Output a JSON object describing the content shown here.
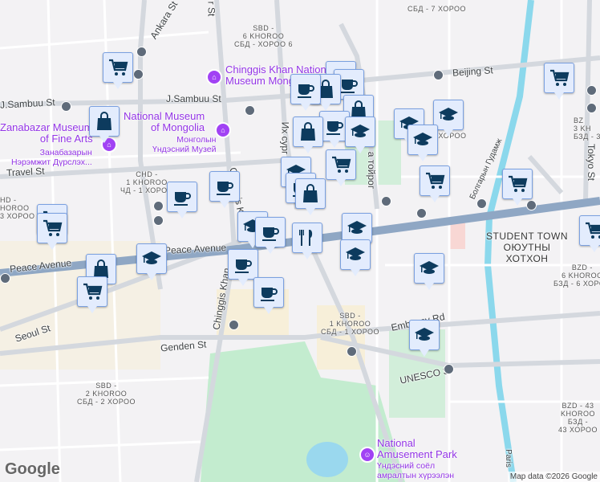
{
  "streets": {
    "ankara": "Ankara St",
    "jsambuu_w": "J.Sambuu St",
    "jsambuu_e": "J.Sambuu St",
    "travel": "Travel St",
    "peace_w": "Peace Avenue",
    "peace_e": "Peace Avenue",
    "seoul": "Seoul St",
    "genden": "Genden St",
    "chinggis_n": "Chinggis Khan",
    "chinggis_s": "Chinggis Khan",
    "ih_surguuli": "Их сург",
    "beijing": "Beijing St",
    "embassy": "Embassy Rd",
    "unesco": "UNESCO St",
    "tokyo": "Tokyo St",
    "bolgar": "Болгарын Гудамж",
    "toirog": "а тойрог",
    "paris": "Paris",
    "chr_st": "r St"
  },
  "districts": {
    "sbd6": "SBD -\n6 KHOROO\nСБД - ХОРОО 6",
    "sbd7": "СБД - 7 ХОРОО",
    "chd1": "CHD -\n1 KHOROO\nЧД - 1 ХОРОО",
    "chd3": "HD -\nHOROO\n3 ХОРОО",
    "sbd1": "SBD -\n1 KHOROO\nСБД - 1 ХОРОО",
    "sbd2": "SBD -\n2 KHOROO\nСБД - 2 ХОРОО",
    "bzd6": "BZD -\n6 KHOROO\nБЗД - 6 ХОРОО",
    "bzd43": "BZD - 43\nKHOROO\nБЗД -\n43 ХОРОО",
    "bzd3": "BZ\n3 KH\nБЗД - 3",
    "sbd3": "3 ХОРОО",
    "student_town": "STUDENT TOWN\nОЮУТНЫ\nХОТХОН"
  },
  "pois": {
    "chinggis_museum": "Chinggis Khan National\nMuseum Mongolia",
    "national_museum": "National Museum\nof Mongolia",
    "national_museum_mn": "Монголын\nҮндэсний Музей",
    "zanabazar": "Zanabazar Museum\nof Fine Arts",
    "zanabazar_mn": "Занабазарын\nНэрэмжит Дүрслэх...",
    "amusement": "National\nAmusement Park",
    "amusement_mn": "Үндэсний соёл\nамралтын хүрээлэн"
  },
  "marker_types": {
    "cart": "shopping-cart-icon",
    "bag": "shopping-bag-icon",
    "cup": "coffee-cup-icon",
    "grad": "graduation-cap-icon",
    "fork": "restaurant-icon"
  },
  "footer": {
    "logo": "Google",
    "attribution": "Map data ©2026 Google"
  }
}
